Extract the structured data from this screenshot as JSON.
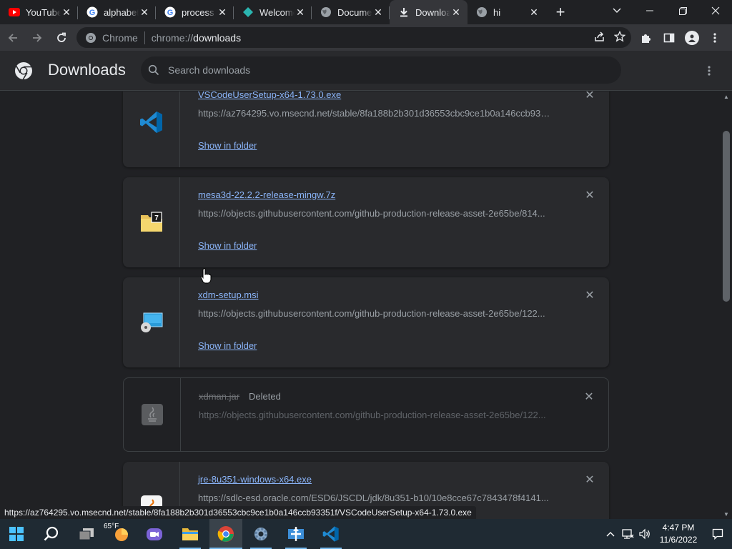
{
  "tabs": [
    {
      "title": "YouTube",
      "icon": "youtube-icon",
      "active": false
    },
    {
      "title": "alphabet",
      "icon": "google-icon",
      "active": false
    },
    {
      "title": "process",
      "icon": "google-icon",
      "active": false
    },
    {
      "title": "Welcome",
      "icon": "diamond-icon",
      "active": false
    },
    {
      "title": "Document",
      "icon": "globe-icon",
      "active": false
    },
    {
      "title": "Downloads",
      "icon": "download-icon",
      "active": true
    },
    {
      "title": "hi",
      "icon": "globe-icon",
      "active": false
    }
  ],
  "omnibox": {
    "site_label": "Chrome",
    "url_scheme": "chrome://",
    "url_host": "downloads"
  },
  "downloads_page": {
    "title": "Downloads",
    "search_placeholder": "Search downloads"
  },
  "items": [
    {
      "filename": "VSCodeUserSetup-x64-1.73.0.exe",
      "url": "https://az764295.vo.msecnd.net/stable/8fa188b2b301d36553cbc9ce1b0a146ccb93351f/VSCodeUserSetup-x64-1.73.0.exe",
      "action": "Show in folder",
      "icon": "vscode-icon",
      "status": ""
    },
    {
      "filename": "mesa3d-22.2.2-release-mingw.7z",
      "url": "https://objects.githubusercontent.com/github-production-release-asset-2e65be/814...",
      "action": "Show in folder",
      "icon": "7zip-archive-icon",
      "status": ""
    },
    {
      "filename": "xdm-setup.msi",
      "url": "https://objects.githubusercontent.com/github-production-release-asset-2e65be/122...",
      "action": "Show in folder",
      "icon": "msi-installer-icon",
      "status": ""
    },
    {
      "filename": "xdman.jar",
      "url": "https://objects.githubusercontent.com/github-production-release-asset-2e65be/122...",
      "action": "",
      "icon": "java-icon",
      "status": "Deleted"
    },
    {
      "filename": "jre-8u351-windows-x64.exe",
      "url": "https://sdlc-esd.oracle.com/ESD6/JSCDL/jdk/8u351-b10/10e8cce67c7843478f4141...",
      "action": "",
      "icon": "java-installer-icon",
      "status": ""
    }
  ],
  "status_bar": {
    "text": "https://az764295.vo.msecnd.net/stable/8fa188b2b301d36553cbc9ce1b0a146ccb93351f/VSCodeUserSetup-x64-1.73.0.exe"
  },
  "taskbar": {
    "weather": "65°F",
    "time": "4:47 PM",
    "date": "11/6/2022",
    "apps": [
      "start-icon",
      "search-icon",
      "task-view-icon",
      "weather-icon",
      "meet-icon",
      "file-explorer-icon",
      "chrome-icon",
      "settings-icon",
      "network-app-icon",
      "vscode-icon"
    ]
  },
  "colors": {
    "accent": "#8ab4f8",
    "background": "#202124",
    "card": "#292a2d"
  }
}
